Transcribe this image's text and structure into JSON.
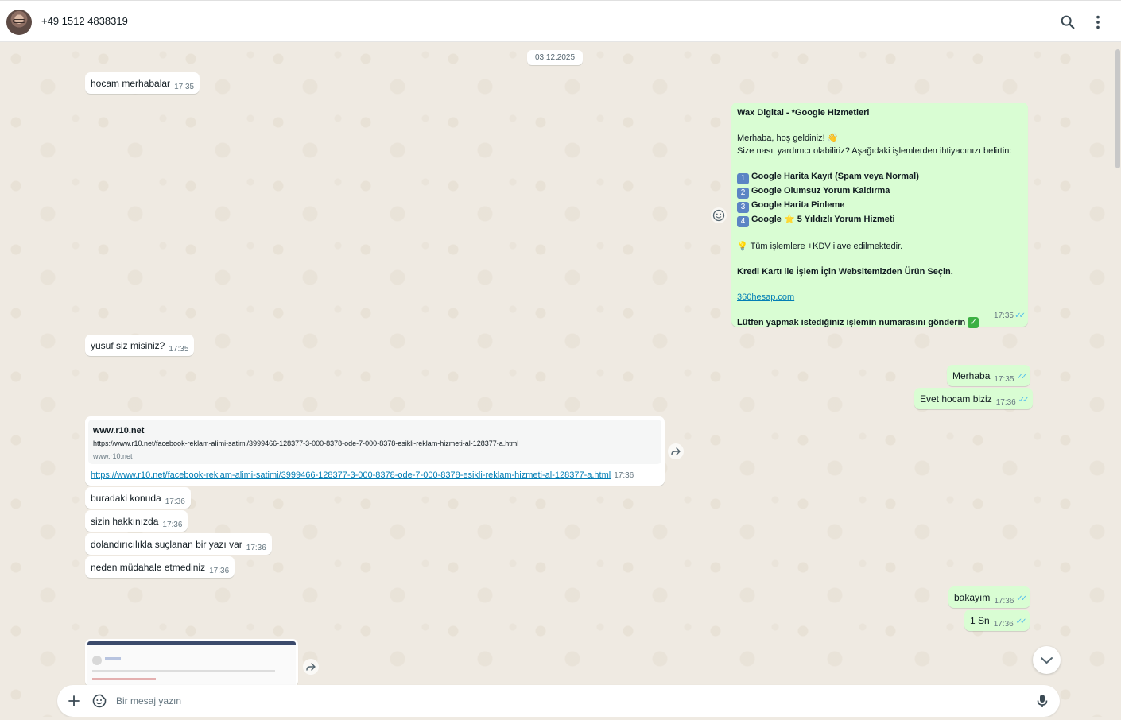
{
  "header": {
    "contact_name": "+49 1512 4838319"
  },
  "date_chip": "03.12.2025",
  "messages": {
    "m1": {
      "text": "hocam merhabalar",
      "time": "17:35"
    },
    "m2": {
      "text": "yusuf siz misiniz?",
      "time": "17:35"
    },
    "m3": {
      "text": "Merhaba",
      "time": "17:35"
    },
    "m4": {
      "text": "Evet hocam biziz",
      "time": "17:36"
    },
    "m5": {
      "text": "buradaki konuda",
      "time": "17:36"
    },
    "m6": {
      "text": "sizin hakkınızda",
      "time": "17:36"
    },
    "m7": {
      "text": "dolandırıcılıkla suçlanan bir yazı var",
      "time": "17:36"
    },
    "m8": {
      "text": "neden müdahale etmediniz",
      "time": "17:36"
    },
    "m9": {
      "text": "bakayım",
      "time": "17:36"
    },
    "m10": {
      "text": "1 Sn",
      "time": "17:36"
    }
  },
  "auto_reply": {
    "title": "Wax Digital - *Google Hizmetleri",
    "greeting": "Merhaba, hoş geldiniz!",
    "question": "Size nasıl yardımcı olabiliriz? Aşağıdaki işlemlerden ihtiyacınızı belirtin:",
    "options": [
      {
        "num": "1",
        "label": "Google Harita Kayıt (Spam veya Normal)"
      },
      {
        "num": "2",
        "label": "Google Olumsuz Yorum Kaldırma"
      },
      {
        "num": "3",
        "label": "Google Harita Pinleme"
      },
      {
        "num": "4",
        "label_pre": "Google",
        "label_post": "5 Yıldızlı Yorum Hizmeti"
      }
    ],
    "kdv_note": "Tüm işlemlere +KDV ilave edilmektedir.",
    "card_note": "Kredi Kartı ile İşlem İçin Websitemizden Ürün Seçin.",
    "website": "360hesap.com",
    "closing": "Lütfen yapmak istediğiniz işlemin numarasını gönderin",
    "time": "17:35"
  },
  "link_message": {
    "preview_title": "www.r10.net",
    "preview_url": "https://www.r10.net/facebook-reklam-alimi-satimi/3999466-128377-3-000-8378-ode-7-000-8378-esikli-reklam-hizmeti-al-128377-a.html",
    "preview_domain": "www.r10.net",
    "url": "https://www.r10.net/facebook-reklam-alimi-satimi/3999466-128377-3-000-8378-ode-7-000-8378-esikli-reklam-hizmeti-al-128377-a.html",
    "time": "17:36"
  },
  "composer": {
    "placeholder": "Bir mesaj yazın"
  },
  "icons": {
    "search": "search-icon",
    "menu": "kebab-menu-icon",
    "emoji_react": "smiley-icon",
    "forward": "forward-icon",
    "scroll_down": "chevron-down-icon",
    "plus": "plus-icon",
    "sticker": "sticker-icon",
    "mic": "microphone-icon"
  },
  "colors": {
    "incoming_bubble": "#ffffff",
    "outgoing_bubble": "#d9fdd3",
    "read_ticks": "#53bdeb",
    "link": "#027eb5"
  }
}
